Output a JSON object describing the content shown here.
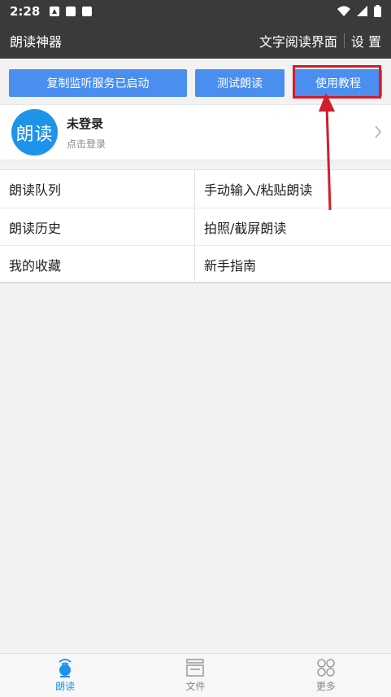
{
  "status_bar": {
    "time": "2:28"
  },
  "app_bar": {
    "title": "朗读神器",
    "reader_ui": "文字阅读界面",
    "settings": "设 置"
  },
  "buttons": {
    "copy_monitor": "复制监听服务已启动",
    "test_read": "测试朗读",
    "tutorial": "使用教程"
  },
  "profile": {
    "avatar_text": "朗读",
    "name": "未登录",
    "sub": "点击登录"
  },
  "menu": [
    {
      "label": "朗读队列"
    },
    {
      "label": "手动输入/粘贴朗读"
    },
    {
      "label": "朗读历史"
    },
    {
      "label": "拍照/截屏朗读"
    },
    {
      "label": "我的收藏"
    },
    {
      "label": "新手指南"
    }
  ],
  "bottom_nav": [
    {
      "label": "朗读",
      "icon": "read-icon",
      "active": true
    },
    {
      "label": "文件",
      "icon": "file-icon",
      "active": false
    },
    {
      "label": "更多",
      "icon": "more-icon",
      "active": false
    }
  ],
  "colors": {
    "accent": "#4a8ff0",
    "highlight": "#d11e2a",
    "avatar": "#1d93ea",
    "app_bar": "#3a3a3a"
  }
}
